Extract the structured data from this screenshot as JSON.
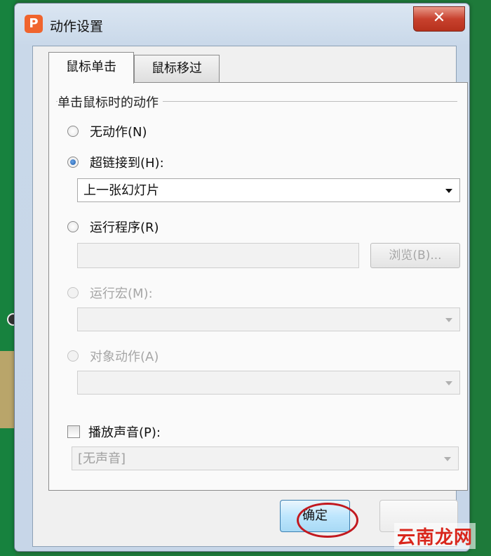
{
  "window": {
    "title": "动作设置",
    "app_icon_glyph": "P",
    "close_glyph": "✕"
  },
  "tabs": [
    {
      "label": "鼠标单击",
      "active": true
    },
    {
      "label": "鼠标移过",
      "active": false
    }
  ],
  "group": {
    "title": "单击鼠标时的动作"
  },
  "options": {
    "no_action": "无动作(N)",
    "hyperlink": "超链接到(H):",
    "hyperlink_value": "上一张幻灯片",
    "run_program": "运行程序(R)",
    "browse": "浏览(B)...",
    "run_macro": "运行宏(M):",
    "object_action": "对象动作(A)"
  },
  "sound": {
    "label": "播放声音(P):",
    "value": "[无声音]"
  },
  "buttons": {
    "ok": "确定"
  },
  "watermark": "云南龙网",
  "colors": {
    "close_red": "#c8412e",
    "ok_blue": "#bee6fd",
    "highlight_ring": "#c2191f",
    "app_icon_orange": "#f0642d"
  }
}
